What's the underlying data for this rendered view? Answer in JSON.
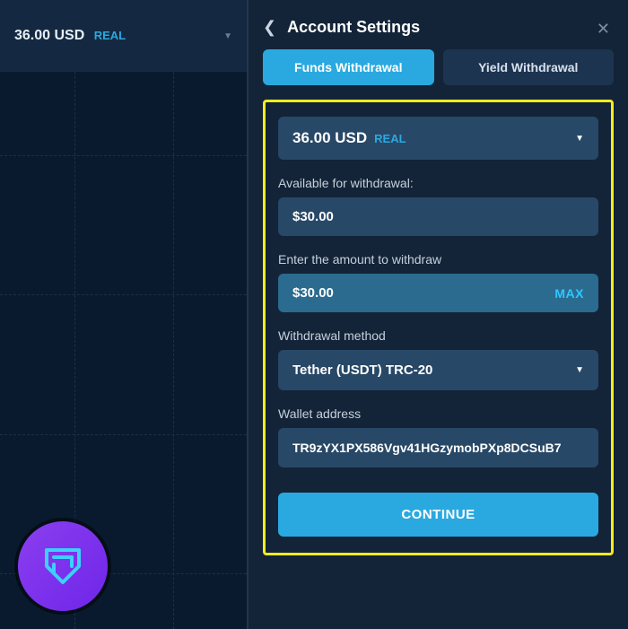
{
  "topbar": {
    "balance": "36.00 USD",
    "badge": "REAL"
  },
  "panel": {
    "title": "Account Settings"
  },
  "tabs": {
    "funds": "Funds Withdrawal",
    "yield": "Yield Withdrawal"
  },
  "form": {
    "account_amount": "36.00 USD",
    "account_badge": "REAL",
    "available_label": "Available for withdrawal:",
    "available_value": "$30.00",
    "amount_label": "Enter the amount to withdraw",
    "amount_value": "$30.00",
    "max_label": "MAX",
    "method_label": "Withdrawal method",
    "method_value": "Tether (USDT) TRC-20",
    "wallet_label": "Wallet address",
    "wallet_value": "TR9zYX1PX586Vgv41HGzymobPXp8DCSuB7",
    "continue": "CONTINUE"
  }
}
